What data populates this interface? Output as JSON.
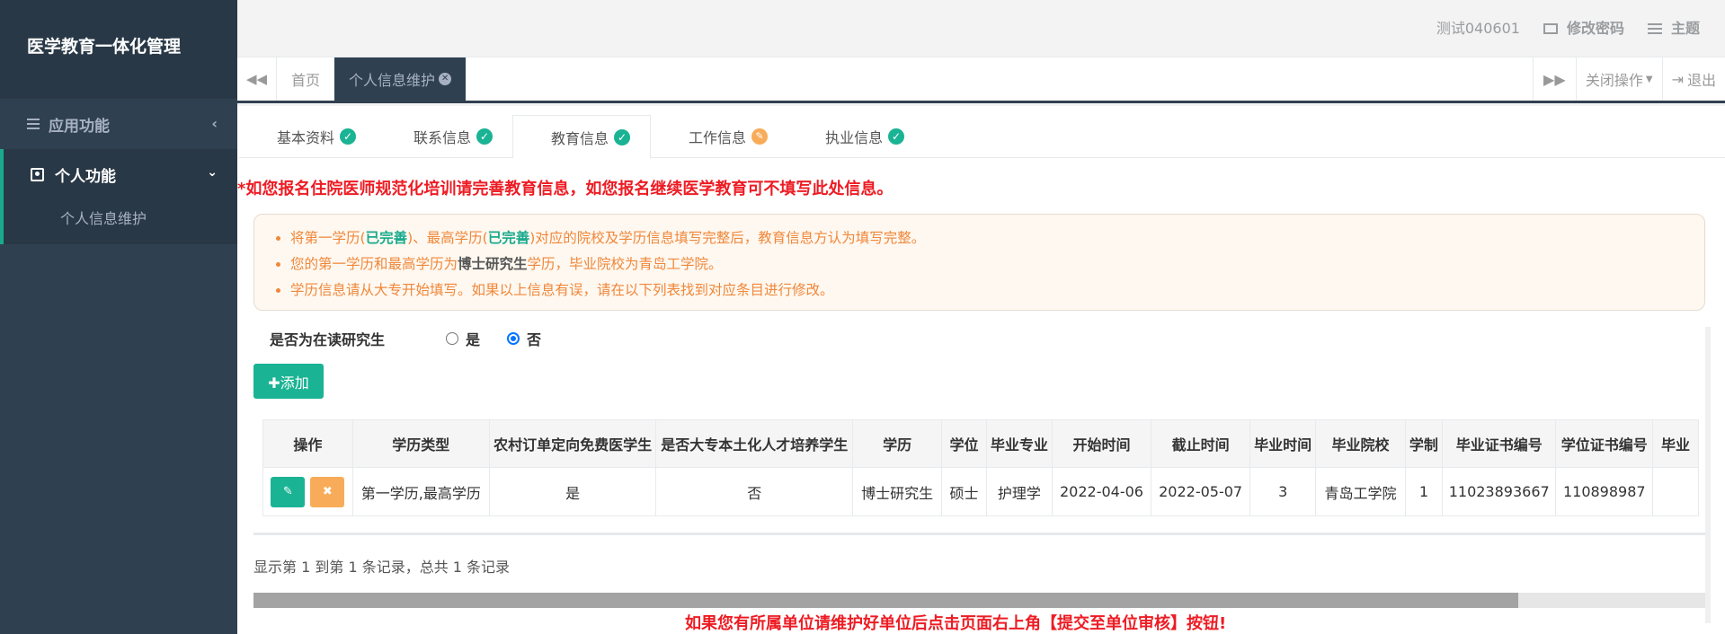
{
  "app": {
    "title": "医学教育一体化管理"
  },
  "sidebar": {
    "group1": {
      "label": "应用功能"
    },
    "group2": {
      "label": "个人功能",
      "items": [
        {
          "label": "个人信息维护"
        }
      ]
    }
  },
  "topbar": {
    "user": "测试040601",
    "change_password": "修改密码",
    "theme": "主题"
  },
  "tabbar": {
    "tabs": [
      {
        "label": "首页"
      },
      {
        "label": "个人信息维护"
      }
    ],
    "close_ops": "关闭操作",
    "logout": "退出"
  },
  "subtabs": [
    {
      "label": "基本资料",
      "status": "done"
    },
    {
      "label": "联系信息",
      "status": "done"
    },
    {
      "label": "教育信息",
      "status": "done"
    },
    {
      "label": "工作信息",
      "status": "edit"
    },
    {
      "label": "执业信息",
      "status": "done"
    }
  ],
  "warning_top": "*如您报名住院医师规范化培训请完善教育信息，如您报名继续医学教育可不填写此处信息。",
  "info": {
    "line1_a": "将第一学历(",
    "line1_b": "已完善",
    "line1_c": ")、最高学历(",
    "line1_d": "已完善",
    "line1_e": ")对应的院校及学历信息填写完整后，教育信息方认为填写完整。",
    "line2_a": "您的第一学历和最高学历为",
    "line2_b": "博士研究生",
    "line2_c": "学历，毕业院校为青岛工学院。",
    "line3": "学历信息请从大专开始填写。如果以上信息有误，请在以下列表找到对应条目进行修改。"
  },
  "grad_question": {
    "label": "是否为在读研究生",
    "yes": "是",
    "no": "否",
    "selected": "否"
  },
  "add_button": "✚添加",
  "table": {
    "headers": [
      "操作",
      "学历类型",
      "农村订单定向免费医学生",
      "是否大专本土化人才培养学生",
      "学历",
      "学位",
      "毕业专业",
      "开始时间",
      "截止时间",
      "毕业时间",
      "毕业院校",
      "学制",
      "毕业证书编号",
      "学位证书编号",
      "毕业"
    ],
    "rows": [
      [
        "",
        "第一学历,最高学历",
        "是",
        "否",
        "博士研究生",
        "硕士",
        "护理学",
        "2022-04-06",
        "2022-05-07",
        "3",
        "青岛工学院",
        "1",
        "11023893667",
        "110898987",
        ""
      ]
    ]
  },
  "pager_text": "显示第 1 到第 1 条记录，总共 1 条记录",
  "bottom_note": "如果您有所属单位请维护好单位后点击页面右上角【提交至单位审核】按钮!",
  "colors": {
    "sidebar": "#2f4050",
    "accent": "#1ab394",
    "warning": "#f8ac59",
    "alert_red": "#ed1c24"
  }
}
